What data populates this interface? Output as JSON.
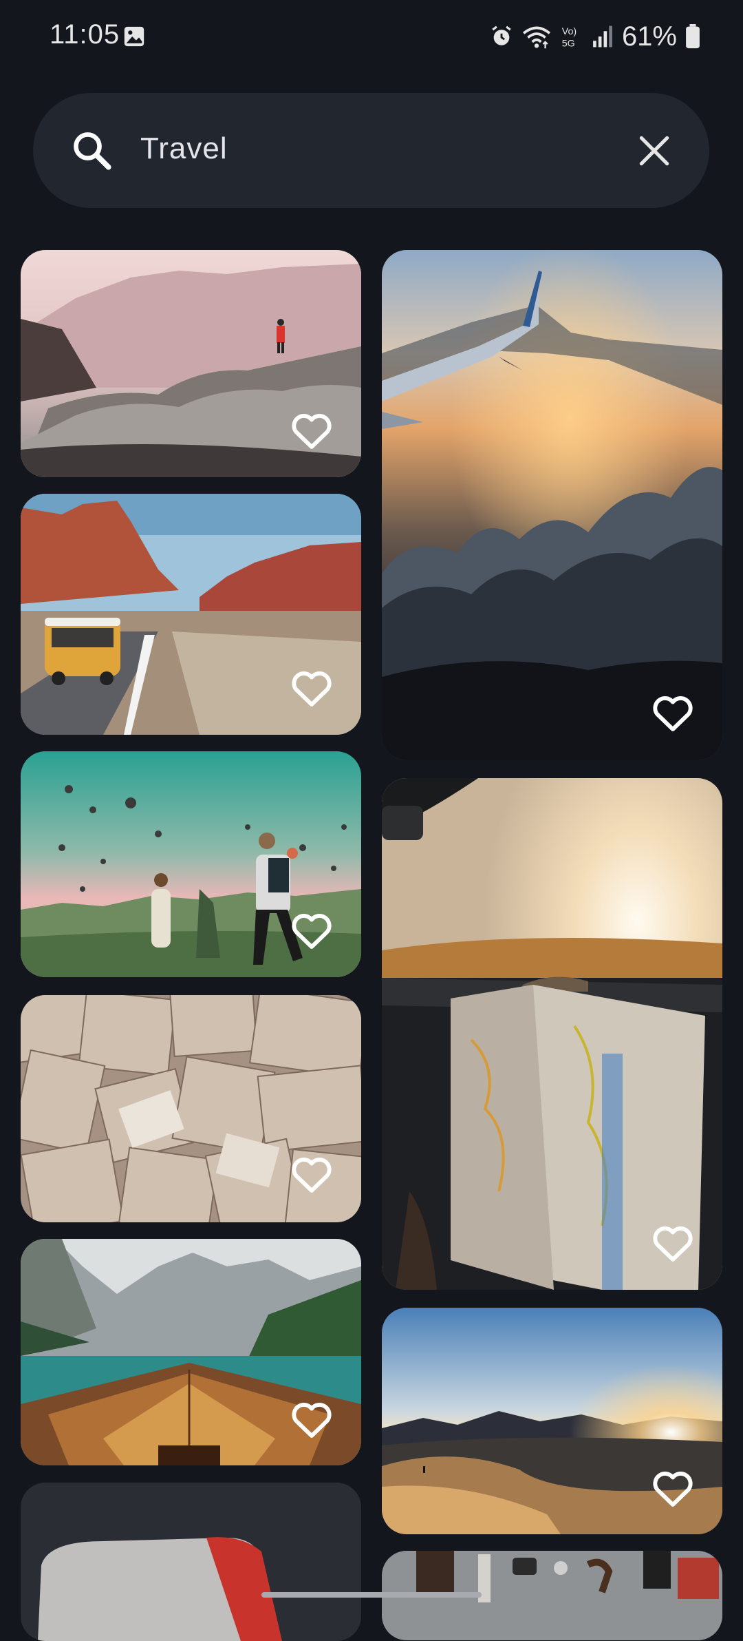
{
  "status_bar": {
    "time": "11:05",
    "battery": "61%",
    "network_label": "Vo) 5G",
    "icons": [
      "image-icon",
      "alarm-icon",
      "wifi-icon",
      "volte-5g-icon",
      "signal-icon",
      "battery-icon"
    ]
  },
  "search": {
    "query": "Travel",
    "icons": [
      "search-icon",
      "close-icon"
    ]
  },
  "gallery": {
    "items": [
      {
        "subject": "hiker on rocks",
        "favorite_icon": "heart-outline-icon"
      },
      {
        "subject": "airplane wing above clouds",
        "favorite_icon": "heart-outline-icon"
      },
      {
        "subject": "yellow van desert road",
        "favorite_icon": "heart-outline-icon"
      },
      {
        "subject": "hot air balloons",
        "favorite_icon": "heart-outline-icon"
      },
      {
        "subject": "map in car",
        "favorite_icon": "heart-outline-icon"
      },
      {
        "subject": "scattered maps",
        "favorite_icon": "heart-outline-icon"
      },
      {
        "subject": "desert dunes sunset",
        "favorite_icon": "heart-outline-icon"
      },
      {
        "subject": "boat on mountain lake",
        "favorite_icon": "heart-outline-icon"
      },
      {
        "subject": "partial image",
        "favorite_icon": ""
      },
      {
        "subject": "travel items flatlay",
        "favorite_icon": ""
      }
    ]
  },
  "colors": {
    "background": "#13161c",
    "search_bar": "#22262e",
    "icon": "#ffffff"
  }
}
